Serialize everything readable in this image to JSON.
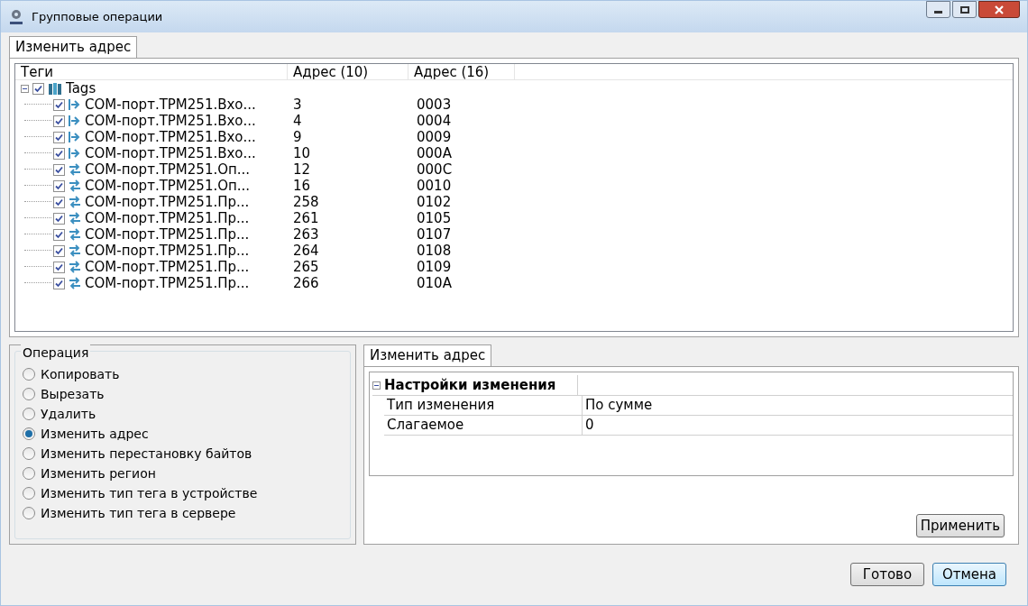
{
  "window": {
    "title": "Групповые операции"
  },
  "top_tab": {
    "label": "Изменить адрес",
    "selected": true
  },
  "tree": {
    "columns": [
      "Теги",
      "Адрес (10)",
      "Адрес (16)"
    ],
    "root": {
      "label": "Tags",
      "checked": true,
      "expanded": true,
      "children": [
        {
          "kind": "input",
          "label": "COM-порт.TPM251.Вхо...",
          "dec": "3",
          "hex": "0003",
          "checked": true
        },
        {
          "kind": "input",
          "label": "COM-порт.TPM251.Вхо...",
          "dec": "4",
          "hex": "0004",
          "checked": true
        },
        {
          "kind": "input",
          "label": "COM-порт.TPM251.Вхо...",
          "dec": "9",
          "hex": "0009",
          "checked": true
        },
        {
          "kind": "input",
          "label": "COM-порт.TPM251.Вхо...",
          "dec": "10",
          "hex": "000A",
          "checked": true
        },
        {
          "kind": "readwrite",
          "label": "COM-порт.TPM251.Оп...",
          "dec": "12",
          "hex": "000C",
          "checked": true
        },
        {
          "kind": "readwrite",
          "label": "COM-порт.TPM251.Оп...",
          "dec": "16",
          "hex": "0010",
          "checked": true
        },
        {
          "kind": "readwrite",
          "label": "COM-порт.TPM251.Пр...",
          "dec": "258",
          "hex": "0102",
          "checked": true
        },
        {
          "kind": "readwrite",
          "label": "COM-порт.TPM251.Пр...",
          "dec": "261",
          "hex": "0105",
          "checked": true
        },
        {
          "kind": "readwrite",
          "label": "COM-порт.TPM251.Пр...",
          "dec": "263",
          "hex": "0107",
          "checked": true
        },
        {
          "kind": "readwrite",
          "label": "COM-порт.TPM251.Пр...",
          "dec": "264",
          "hex": "0108",
          "checked": true
        },
        {
          "kind": "readwrite",
          "label": "COM-порт.TPM251.Пр...",
          "dec": "265",
          "hex": "0109",
          "checked": true
        },
        {
          "kind": "readwrite",
          "label": "COM-порт.TPM251.Пр...",
          "dec": "266",
          "hex": "010A",
          "checked": true
        }
      ]
    }
  },
  "operation": {
    "title": "Операция",
    "options": [
      {
        "label": "Копировать",
        "selected": false
      },
      {
        "label": "Вырезать",
        "selected": false
      },
      {
        "label": "Удалить",
        "selected": false
      },
      {
        "label": "Изменить адрес",
        "selected": true
      },
      {
        "label": "Изменить перестановку байтов",
        "selected": false
      },
      {
        "label": "Изменить регион",
        "selected": false
      },
      {
        "label": "Изменить тип тега в устройстве",
        "selected": false
      },
      {
        "label": "Изменить тип тега в сервере",
        "selected": false
      }
    ]
  },
  "settings_tab": {
    "label": "Изменить адрес",
    "selected": true
  },
  "properties": {
    "category": "Настройки изменения",
    "expanded": true,
    "rows": [
      {
        "name": "Тип изменения",
        "value": "По сумме"
      },
      {
        "name": "Слагаемое",
        "value": "0"
      }
    ]
  },
  "apply_button": "Применить",
  "buttons": [
    {
      "label": "Готово",
      "focused": false
    },
    {
      "label": "Отмена",
      "focused": true
    }
  ]
}
